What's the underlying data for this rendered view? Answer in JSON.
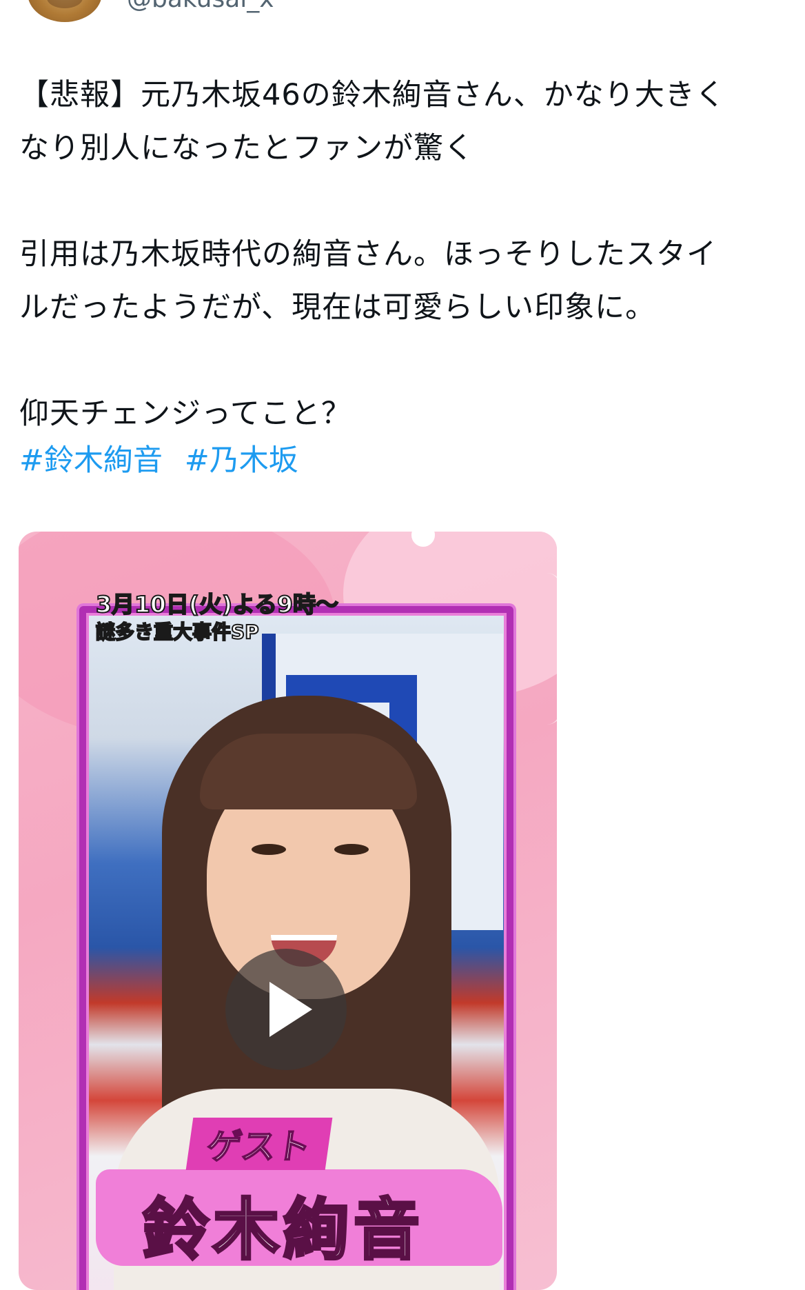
{
  "author": {
    "handle": "@bakusai_x"
  },
  "tweet": {
    "text": "【悲報】元乃木坂46の鈴木絢音さん、かなり大きく\nなり別人になったとファンが驚く\n\n引用は乃木坂時代の絢音さん。ほっそりしたスタイ\nルだったようだが、現在は可愛らしい印象に。\n\n仰天チェンジってこと？",
    "hashtags": [
      "#鈴木絢音",
      "#乃木坂"
    ]
  },
  "video": {
    "caption_line1": "3月10日(火)よる9時〜",
    "caption_line2": "謎多き重大事件SP",
    "guest_label": "ゲスト",
    "guest_name": "鈴木絢音",
    "play_icon": "play-icon"
  },
  "colors": {
    "hashtag": "#1d9bf0",
    "frame": "#b12fb3",
    "background_pink": "#f5a8c1"
  }
}
